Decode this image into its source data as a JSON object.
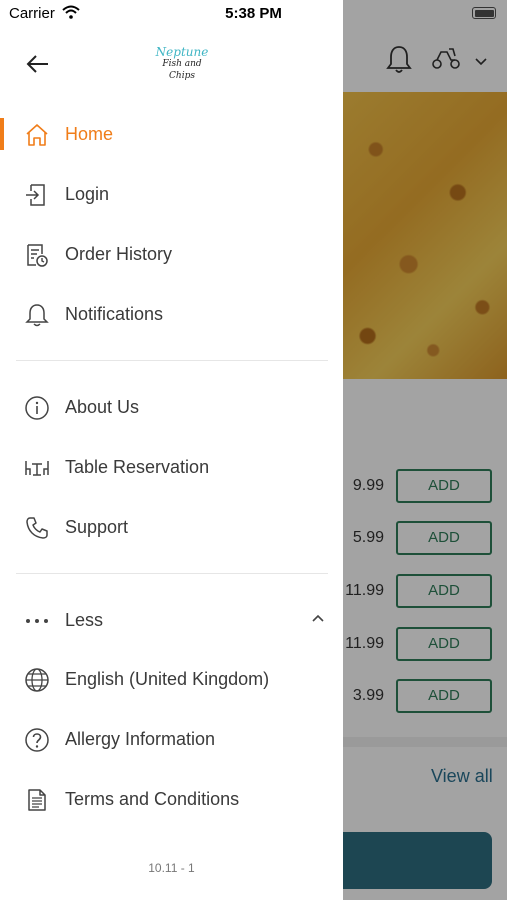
{
  "status_bar": {
    "carrier": "Carrier",
    "time": "5:38 PM"
  },
  "logo": {
    "line1": "Neptune",
    "line2": "Fish and Chips"
  },
  "menu": {
    "primary": [
      {
        "label": "Home",
        "icon": "home-icon",
        "active": true
      },
      {
        "label": "Login",
        "icon": "login-icon"
      },
      {
        "label": "Order History",
        "icon": "order-history-icon"
      },
      {
        "label": "Notifications",
        "icon": "bell-icon"
      }
    ],
    "secondary": [
      {
        "label": "About Us",
        "icon": "info-icon"
      },
      {
        "label": "Table Reservation",
        "icon": "table-icon"
      },
      {
        "label": "Support",
        "icon": "phone-icon"
      }
    ],
    "more": {
      "label": "Less",
      "icon": "more-dots-icon"
    },
    "tertiary": [
      {
        "label": "English (United Kingdom)",
        "icon": "globe-icon"
      },
      {
        "label": "Allergy Information",
        "icon": "question-icon"
      },
      {
        "label": "Terms and Conditions",
        "icon": "document-icon"
      }
    ]
  },
  "version": "10.11 - 1",
  "background": {
    "products": [
      {
        "price": "9.99",
        "button": "ADD"
      },
      {
        "price": "5.99",
        "button": "ADD"
      },
      {
        "price": "11.99",
        "button": "ADD"
      },
      {
        "price": "11.99",
        "button": "ADD"
      },
      {
        "price": "3.99",
        "button": "ADD"
      }
    ],
    "view_all": "View all"
  },
  "colors": {
    "accent": "#f07d19",
    "add_button": "#2f7d5a",
    "link": "#2a6f8f",
    "cart_bar": "#2e6e80"
  }
}
